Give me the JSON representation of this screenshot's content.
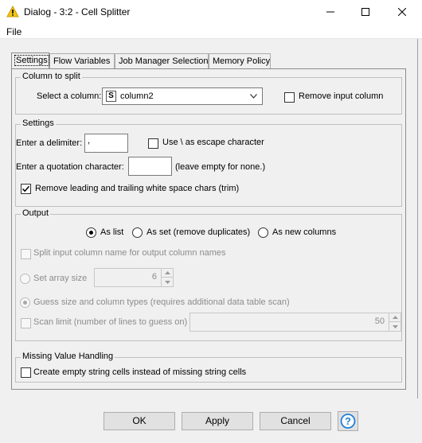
{
  "window": {
    "title": "Dialog - 3:2 - Cell Splitter",
    "icon": "warning-triangle-icon",
    "minimize_icon": "minimize-icon",
    "maximize_icon": "maximize-icon",
    "close_icon": "close-icon"
  },
  "menu": {
    "file": "File"
  },
  "tabs": [
    {
      "label": "Settings",
      "active": true
    },
    {
      "label": "Flow Variables",
      "active": false
    },
    {
      "label": "Job Manager Selection",
      "active": false
    },
    {
      "label": "Memory Policy",
      "active": false
    }
  ],
  "column_to_split": {
    "title": "Column to split",
    "select_label": "Select a column:",
    "column_type_badge": "S",
    "selected_column": "column2",
    "remove_input_label": "Remove input column",
    "remove_input_checked": false
  },
  "settings": {
    "title": "Settings",
    "delimiter_label": "Enter a delimiter:",
    "delimiter_value": ",",
    "escape_label": "Use \\ as escape character",
    "escape_checked": false,
    "quotation_label": "Enter a quotation character:",
    "quotation_value": "",
    "quotation_hint": "(leave empty for none.)",
    "trim_label": "Remove leading and trailing white space chars (trim)",
    "trim_checked": true
  },
  "output": {
    "title": "Output",
    "options": [
      {
        "label": "As list",
        "selected": true
      },
      {
        "label": "As set (remove duplicates)",
        "selected": false
      },
      {
        "label": "As new columns",
        "selected": false
      }
    ],
    "split_names_label": "Split input column name for output column names",
    "set_array_size_label": "Set array size",
    "array_size_value": "6",
    "guess_label": "Guess size and column types (requires additional data table scan)",
    "scan_limit_label": "Scan limit (number of lines to guess on)",
    "scan_limit_value": "50"
  },
  "missing": {
    "title": "Missing Value Handling",
    "empty_cells_label": "Create empty string cells instead of missing string cells",
    "empty_cells_checked": false
  },
  "buttons": {
    "ok": "OK",
    "apply": "Apply",
    "cancel": "Cancel",
    "help_icon": "help-question-icon"
  },
  "colors": {
    "warning": "#f5c518",
    "help": "#1e7fd8",
    "accent": "#0078d7"
  }
}
